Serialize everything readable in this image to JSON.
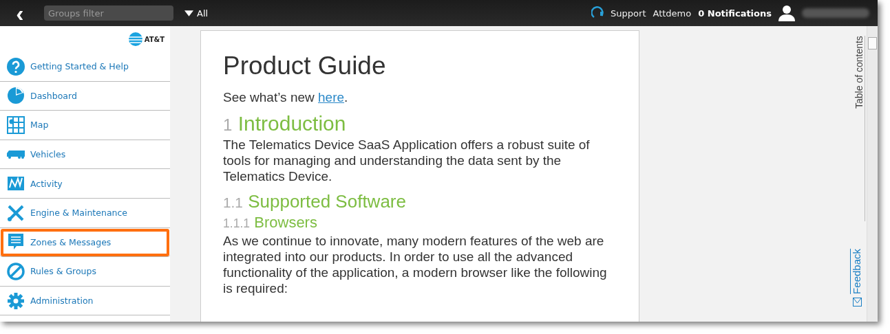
{
  "topbar": {
    "back": "‹",
    "groups_filter": {
      "placeholder": "Groups filter"
    },
    "group_dropdown": "All",
    "support": "Support",
    "account": "Attdemo",
    "notifications": "0 Notifications"
  },
  "sidebar": {
    "logo": "AT&T",
    "items": [
      {
        "label": "Getting Started & Help",
        "kind": "help",
        "selected": false
      },
      {
        "label": "Dashboard",
        "kind": "dashboard",
        "selected": false
      },
      {
        "label": "Map",
        "kind": "map",
        "selected": false
      },
      {
        "label": "Vehicles",
        "kind": "vehicles",
        "selected": false
      },
      {
        "label": "Activity",
        "kind": "activity",
        "selected": false
      },
      {
        "label": "Engine & Maintenance",
        "kind": "maintenance",
        "selected": false
      },
      {
        "label": "Zones & Messages",
        "kind": "messages",
        "selected": true
      },
      {
        "label": "Rules & Groups",
        "kind": "rules",
        "selected": false
      },
      {
        "label": "Administration",
        "kind": "admin",
        "selected": false
      }
    ]
  },
  "document": {
    "title": "Product Guide",
    "intro": "See what’s new",
    "intro_link": "here",
    "intro_end": ".",
    "blocks": [
      {
        "kind": "h1",
        "number": "1",
        "text": "Introduction"
      },
      {
        "kind": "p",
        "text": "The Telematics Device SaaS Application offers a robust suite of tools for managing and understanding the data sent by the Telematics Device."
      },
      {
        "kind": "h2",
        "number": "1.1",
        "text": "Supported Software"
      },
      {
        "kind": "h3",
        "number": "1.1.1",
        "text": "Browsers"
      },
      {
        "kind": "p",
        "text": "As we continue to innovate, many modern features of the web are integrated into our products. In order to use all the advanced functionality of the application, a modern browser like the following is required:"
      }
    ]
  },
  "right_panel": {
    "toc": "Table of contents",
    "feedback": "Feedback"
  }
}
